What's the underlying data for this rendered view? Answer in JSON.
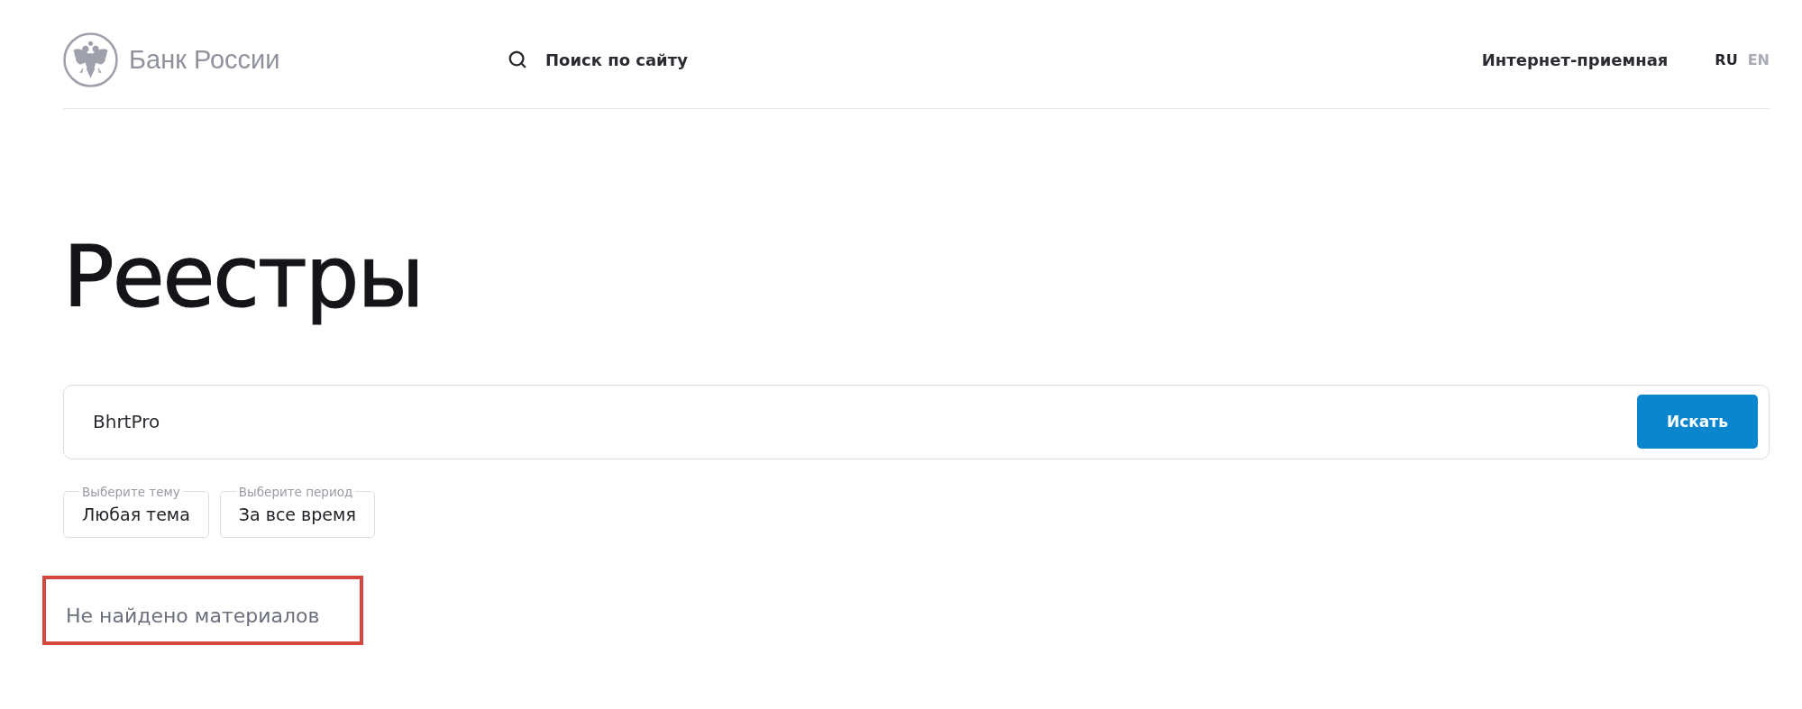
{
  "header": {
    "logo": {
      "text": "Банк России"
    },
    "site_search": {
      "label": "Поиск по сайту"
    },
    "reception_link": "Интернет-приемная",
    "languages": [
      {
        "label": "RU",
        "selected": true
      },
      {
        "label": "EN",
        "selected": false
      }
    ]
  },
  "page": {
    "title": "Реестры"
  },
  "search": {
    "value": "BhrtPro",
    "button": "Искать"
  },
  "filters": [
    {
      "legend": "Выберите тему",
      "value": "Любая тема"
    },
    {
      "legend": "Выберите период",
      "value": "За все время"
    }
  ],
  "no_results": {
    "text": "Не найдено материалов",
    "highlighted": true
  }
}
